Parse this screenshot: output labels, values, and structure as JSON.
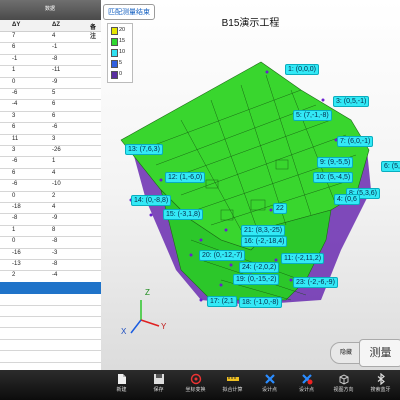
{
  "left_panel": {
    "tab_label": "数据",
    "columns": [
      "ΔY",
      "ΔZ",
      "备注"
    ],
    "rows": [
      [
        "7",
        "4",
        ""
      ],
      [
        "6",
        "-1",
        ""
      ],
      [
        "-1",
        "-8",
        ""
      ],
      [
        "1",
        "-11",
        ""
      ],
      [
        "0",
        "-9",
        ""
      ],
      [
        "-6",
        "5",
        ""
      ],
      [
        "-4",
        "6",
        ""
      ],
      [
        "3",
        "6",
        ""
      ],
      [
        "6",
        "-6",
        ""
      ],
      [
        "11",
        "3",
        ""
      ],
      [
        "3",
        "-26",
        ""
      ],
      [
        "-6",
        "1",
        ""
      ],
      [
        "6",
        "4",
        ""
      ],
      [
        "-6",
        "-10",
        ""
      ],
      [
        "0",
        "2",
        ""
      ],
      [
        "-18",
        "4",
        ""
      ],
      [
        "-8",
        "-9",
        ""
      ],
      [
        "1",
        "8",
        ""
      ],
      [
        "0",
        "-8",
        ""
      ],
      [
        "-16",
        "-3",
        ""
      ],
      [
        "-13",
        "-8",
        ""
      ],
      [
        "2",
        "-4",
        ""
      ]
    ],
    "selected_row": 22
  },
  "viewport": {
    "title": "B15演示工程",
    "fit_button": "匹配测量结束",
    "legend": [
      {
        "label": "20",
        "color": "#e6e600"
      },
      {
        "label": "15",
        "color": "#2fd82f"
      },
      {
        "label": "10",
        "color": "#30e0f0"
      },
      {
        "label": "5",
        "color": "#3060e0"
      },
      {
        "label": "0",
        "color": "#5a2fa0"
      }
    ],
    "axis": {
      "x": "X",
      "y": "Y",
      "z": "Z"
    },
    "point_tags": [
      "1: (0,0,0)",
      "3: (0,5,-1)",
      "5: (7,-1,-8)",
      "7: (6,0,-1)",
      "6: (5,0",
      "13: (7,6,3)",
      "9: (9,-5,5)",
      "10: (5,-4,5)",
      "8: (5,3,6)",
      "4: (0,6",
      "12: (1,-6,0)",
      "14: (0,-8,8)",
      "15: (-3,1,8)",
      "22",
      "21: (8,3,-25)",
      "16: (-2,-18,4)",
      "20: (0,-12,-7)",
      "11: (-2,11,2)",
      "24: (-2,0,2)",
      "19: (0,-15,-2)",
      "23: (-2,-6,-9)",
      "17: (2,1",
      "18: (-1,0,-8)"
    ],
    "hide_button": "隐藏",
    "measure_button": "测量"
  },
  "toolbar": {
    "items": [
      {
        "label": "新建",
        "icon": "new-file-icon"
      },
      {
        "label": "保存",
        "icon": "save-icon"
      },
      {
        "label": "坐标变换",
        "icon": "transform-icon"
      },
      {
        "label": "拟合计算",
        "icon": "fit-calc-icon"
      },
      {
        "label": "设计点",
        "icon": "design-point-icon"
      },
      {
        "label": "设计点",
        "icon": "delete-design-point-icon"
      },
      {
        "label": "视图方向",
        "icon": "view-direction-icon"
      },
      {
        "label": "搜索蓝牙",
        "icon": "bluetooth-icon"
      }
    ]
  }
}
